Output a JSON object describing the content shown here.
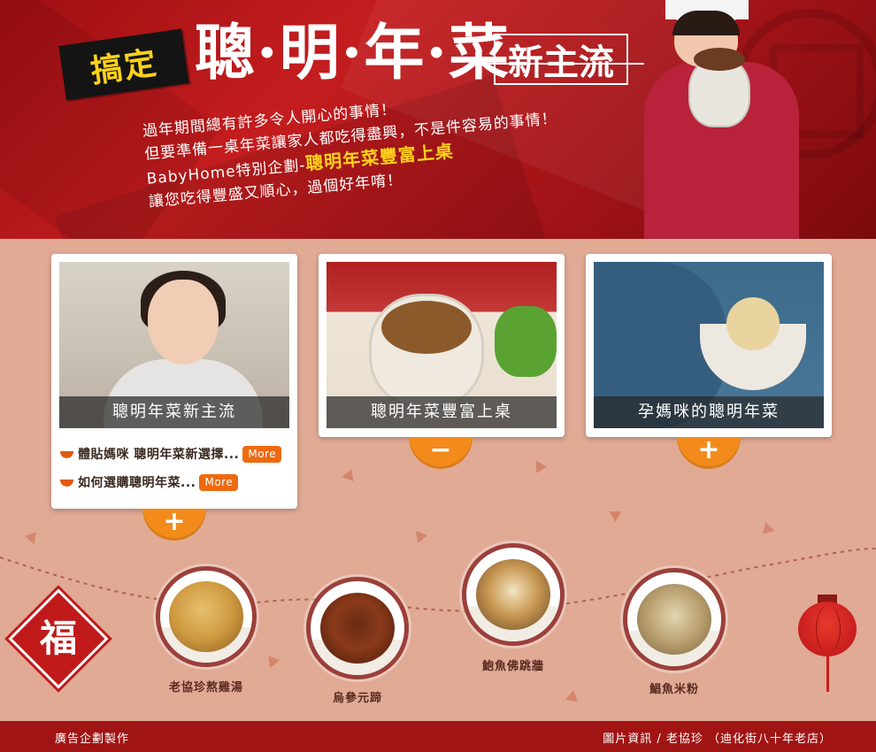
{
  "hero": {
    "tag": "搞定",
    "title": "聰·明·年·菜",
    "badge": "新主流",
    "copy_lines": [
      "過年期間總有許多令人開心的事情！",
      "但要準備一桌年菜讓家人都吃得盡興，不是件容易的事情！"
    ],
    "copy_prefix": "BabyHome特別企劃-",
    "copy_highlight": "聰明年菜豐富上桌",
    "copy_last": "讓您吃得豐盛又順心，過個好年唷！",
    "colors": {
      "background": "#b7191b",
      "tag_text": "#ffd21a",
      "highlight": "#ffd21a"
    }
  },
  "cards": [
    {
      "caption": "聰明年菜新主流",
      "links": [
        {
          "text": "體貼媽咪 聰明年菜新選擇...",
          "more": "More"
        },
        {
          "text": "如何選購聰明年菜...",
          "more": "More"
        }
      ],
      "toggle": "+"
    },
    {
      "caption": "聰明年菜豐富上桌",
      "toggle": "−"
    },
    {
      "caption": "孕媽咪的聰明年菜",
      "toggle": "+"
    }
  ],
  "dishes": [
    {
      "label": "老協珍熬雞湯"
    },
    {
      "label": "烏參元蹄"
    },
    {
      "label": "鮑魚佛跳牆"
    },
    {
      "label": "鯧魚米粉"
    }
  ],
  "fu_char": "福",
  "icons": [
    "bowl-icon",
    "fu-diamond-icon",
    "lantern-icon",
    "plus-icon",
    "minus-icon"
  ],
  "footer": {
    "left": "廣告企劃製作",
    "right": "圖片資訊 / 老協珍 （迪化街八十年老店）"
  },
  "colors": {
    "page_background": "#e0aa95",
    "toggle": "#f28b1c",
    "more_button": "#ee6a10",
    "footer": "#a11414"
  }
}
